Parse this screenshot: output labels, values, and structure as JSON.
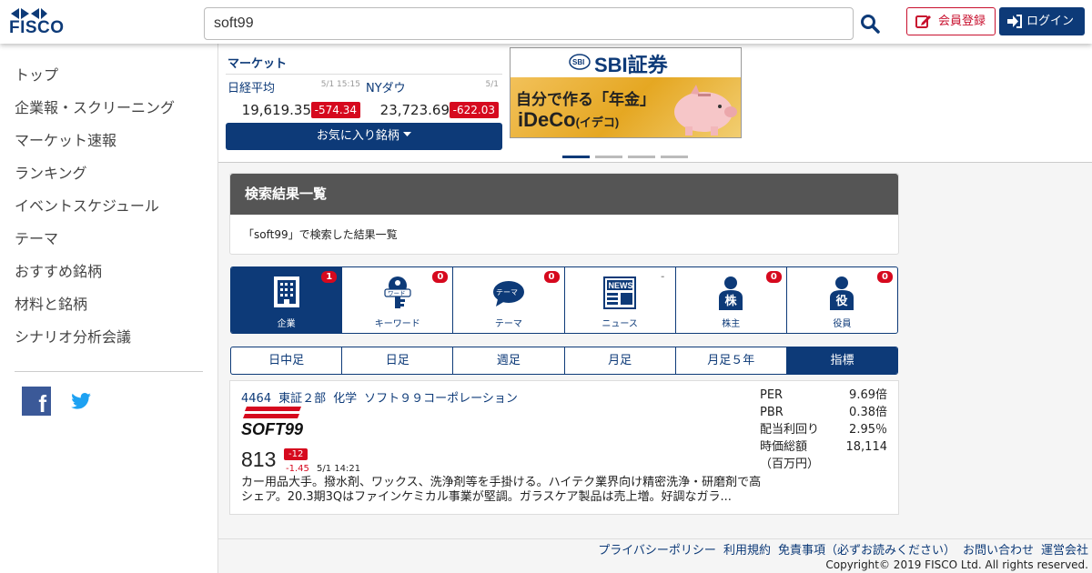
{
  "header": {
    "logo_text": "FISCO",
    "search_value": "soft99",
    "register_label": "会員登録",
    "login_label": "ログイン"
  },
  "sidebar": {
    "items": [
      {
        "label": "トップ"
      },
      {
        "label": "企業報・スクリーニング"
      },
      {
        "label": "マーケット速報"
      },
      {
        "label": "ランキング"
      },
      {
        "label": "イベントスケジュール"
      },
      {
        "label": "テーマ"
      },
      {
        "label": "おすすめ銘柄"
      },
      {
        "label": "材料と銘柄"
      },
      {
        "label": "シナリオ分析会議"
      }
    ],
    "social": {
      "facebook_letter": "f"
    }
  },
  "market": {
    "title": "マーケット",
    "nikkei": {
      "name": "日経平均",
      "time": "5/1 15:15",
      "value": "19,619.35",
      "change": "-574.34"
    },
    "nydow": {
      "name": "NYダウ",
      "time": "5/1",
      "value": "23,723.69",
      "change": "-622.03"
    },
    "favorites_label": "お気に入り銘柄"
  },
  "ad": {
    "brand": "SBI証券",
    "line1": "自分で作る「年金」",
    "line2": "iDeCo",
    "line2_small": "(イデコ)"
  },
  "search_panel": {
    "title": "検索結果一覧",
    "description": "「soft99」で検索した結果一覧"
  },
  "category_tabs": [
    {
      "label": "企業",
      "count": "1"
    },
    {
      "label": "キーワード",
      "count": "0"
    },
    {
      "label": "テーマ",
      "count": "0"
    },
    {
      "label": "ニュース",
      "count": "-"
    },
    {
      "label": "株主",
      "count": "0"
    },
    {
      "label": "役員",
      "count": "0"
    }
  ],
  "period_tabs": [
    {
      "label": "日中足"
    },
    {
      "label": "日足"
    },
    {
      "label": "週足"
    },
    {
      "label": "月足"
    },
    {
      "label": "月足５年"
    },
    {
      "label": "指標"
    }
  ],
  "result": {
    "code": "4464",
    "market": "東証２部",
    "sector": "化学",
    "name": "ソフト９９コーポレーション",
    "logo_text": "SOFT99",
    "price": "813",
    "change": "-12",
    "change_pct": "-1.45",
    "time": "5/1 14:21",
    "description": "カー用品大手。撥水剤、ワックス、洗浄剤等を手掛ける。ハイテク業界向け精密洗浄・研磨剤で高シェア。20.3期3Qはファインケミカル事業が堅調。ガラスケア製品は売上増。好調なガラ...",
    "metrics": [
      {
        "key": "PER",
        "value": "9.69倍"
      },
      {
        "key": "PBR",
        "value": "0.38倍"
      },
      {
        "key": "配当利回り",
        "value": "2.95％"
      },
      {
        "key": "時価総額",
        "value": "18,114"
      }
    ],
    "metrics_unit": "（百万円）"
  },
  "footer": {
    "links": [
      "プライバシーポリシー",
      "利用規約",
      "免責事項（必ずお読みください）",
      "お問い合わせ",
      "運営会社"
    ],
    "copyright": "Copyright© 2019 FISCO Ltd. All rights reserved."
  },
  "colors": {
    "brand": "#0d3a78",
    "down": "#d6091e",
    "panel_head": "#555555"
  }
}
